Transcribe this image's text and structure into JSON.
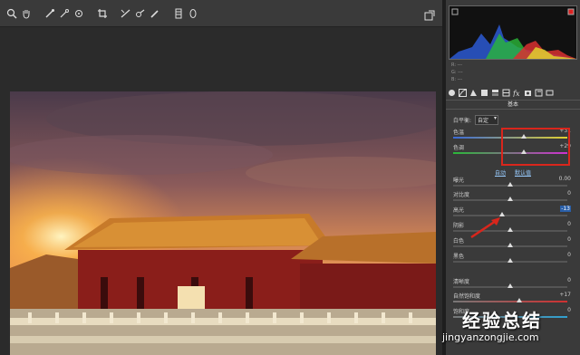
{
  "toolbar": {
    "icons": [
      "zoom-icon",
      "hand-icon",
      "white-balance-icon",
      "color-sampler-icon",
      "target-adjust-icon",
      "crop-icon",
      "straighten-icon",
      "spot-removal-icon",
      "red-eye-icon",
      "adjustment-brush-icon",
      "graduated-filter-icon",
      "radial-filter-icon"
    ]
  },
  "rgb": {
    "r": "R: ---",
    "g": "G: ---",
    "b": "B: ---"
  },
  "panel": {
    "section_title": "基本",
    "white_balance": {
      "label": "白平衡:",
      "value": "自定"
    },
    "auto_label": "自动",
    "default_label": "默认值",
    "sliders": [
      {
        "label": "色温",
        "value": "+31",
        "pos": 0.62
      },
      {
        "label": "色调",
        "value": "+29",
        "pos": 0.62
      },
      {
        "label": "曝光",
        "value": "0.00",
        "pos": 0.5
      },
      {
        "label": "对比度",
        "value": "0",
        "pos": 0.5
      },
      {
        "label": "高光",
        "value": "-13",
        "pos": 0.43
      },
      {
        "label": "阴影",
        "value": "0",
        "pos": 0.5
      },
      {
        "label": "白色",
        "value": "0",
        "pos": 0.5
      },
      {
        "label": "黑色",
        "value": "0",
        "pos": 0.5
      },
      {
        "label": "清晰度",
        "value": "0",
        "pos": 0.5
      },
      {
        "label": "自然饱和度",
        "value": "+17",
        "pos": 0.58
      },
      {
        "label": "饱和度",
        "value": "0",
        "pos": 0.5
      }
    ]
  },
  "watermark": {
    "text": "经验总结",
    "url": "jingyanzongjie.com"
  }
}
